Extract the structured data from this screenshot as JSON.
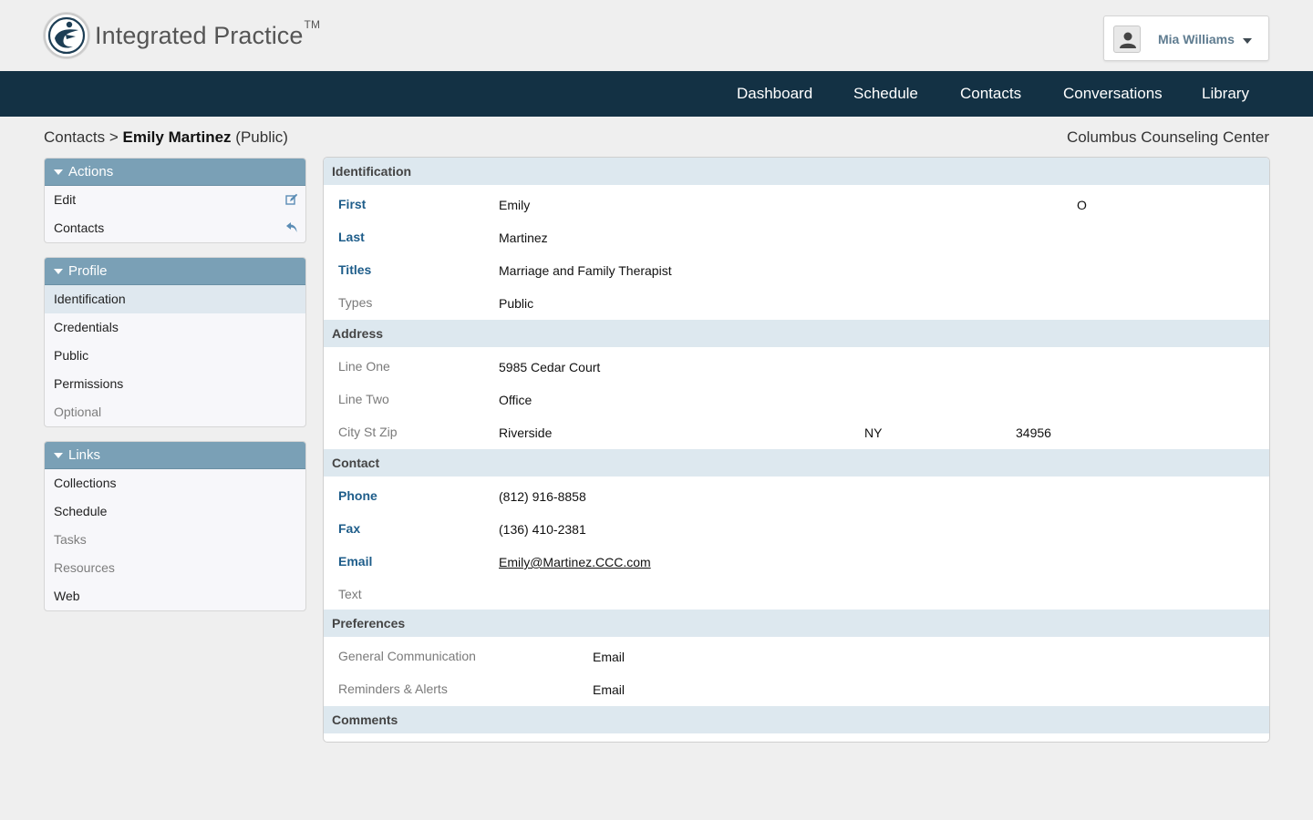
{
  "brand": {
    "name": "Integrated Practice",
    "tm": "TM"
  },
  "user": {
    "name": "Mia Williams"
  },
  "nav": [
    "Dashboard",
    "Schedule",
    "Contacts",
    "Conversations",
    "Library"
  ],
  "breadcrumb": {
    "root": "Contacts",
    "sep": ">",
    "current": "Emily Martinez",
    "qualifier": "(Public)"
  },
  "organization": "Columbus Counseling Center",
  "sidebar": {
    "actions": {
      "title": "Actions",
      "items": [
        "Edit",
        "Contacts"
      ]
    },
    "profile": {
      "title": "Profile",
      "items": [
        "Identification",
        "Credentials",
        "Public",
        "Permissions",
        "Optional"
      ]
    },
    "links": {
      "title": "Links",
      "items": [
        "Collections",
        "Schedule",
        "Tasks",
        "Resources",
        "Web"
      ]
    }
  },
  "sections": {
    "identification": "Identification",
    "address": "Address",
    "contact": "Contact",
    "preferences": "Preferences",
    "comments": "Comments"
  },
  "identification": {
    "first_label": "First",
    "first": "Emily",
    "first_extra": "O",
    "last_label": "Last",
    "last": "Martinez",
    "titles_label": "Titles",
    "titles": "Marriage and Family Therapist",
    "types_label": "Types",
    "types": "Public"
  },
  "address": {
    "line1_label": "Line One",
    "line1": "5985 Cedar Court",
    "line2_label": "Line Two",
    "line2": "Office",
    "csz_label": "City St Zip",
    "city": "Riverside",
    "state": "NY",
    "zip": "34956"
  },
  "contact": {
    "phone_label": "Phone",
    "phone": "(812) 916-8858",
    "fax_label": "Fax",
    "fax": "(136) 410-2381",
    "email_label": "Email",
    "email": "Emily@Martinez.CCC.com",
    "text_label": "Text"
  },
  "preferences": {
    "general_label": "General Communication",
    "general": "Email",
    "reminders_label": "Reminders & Alerts",
    "reminders": "Email"
  },
  "colors": {
    "navbar": "#133144",
    "panel_header": "#7aa0b6",
    "section_band": "#dde8ef",
    "label_blue": "#1e5d8a"
  }
}
